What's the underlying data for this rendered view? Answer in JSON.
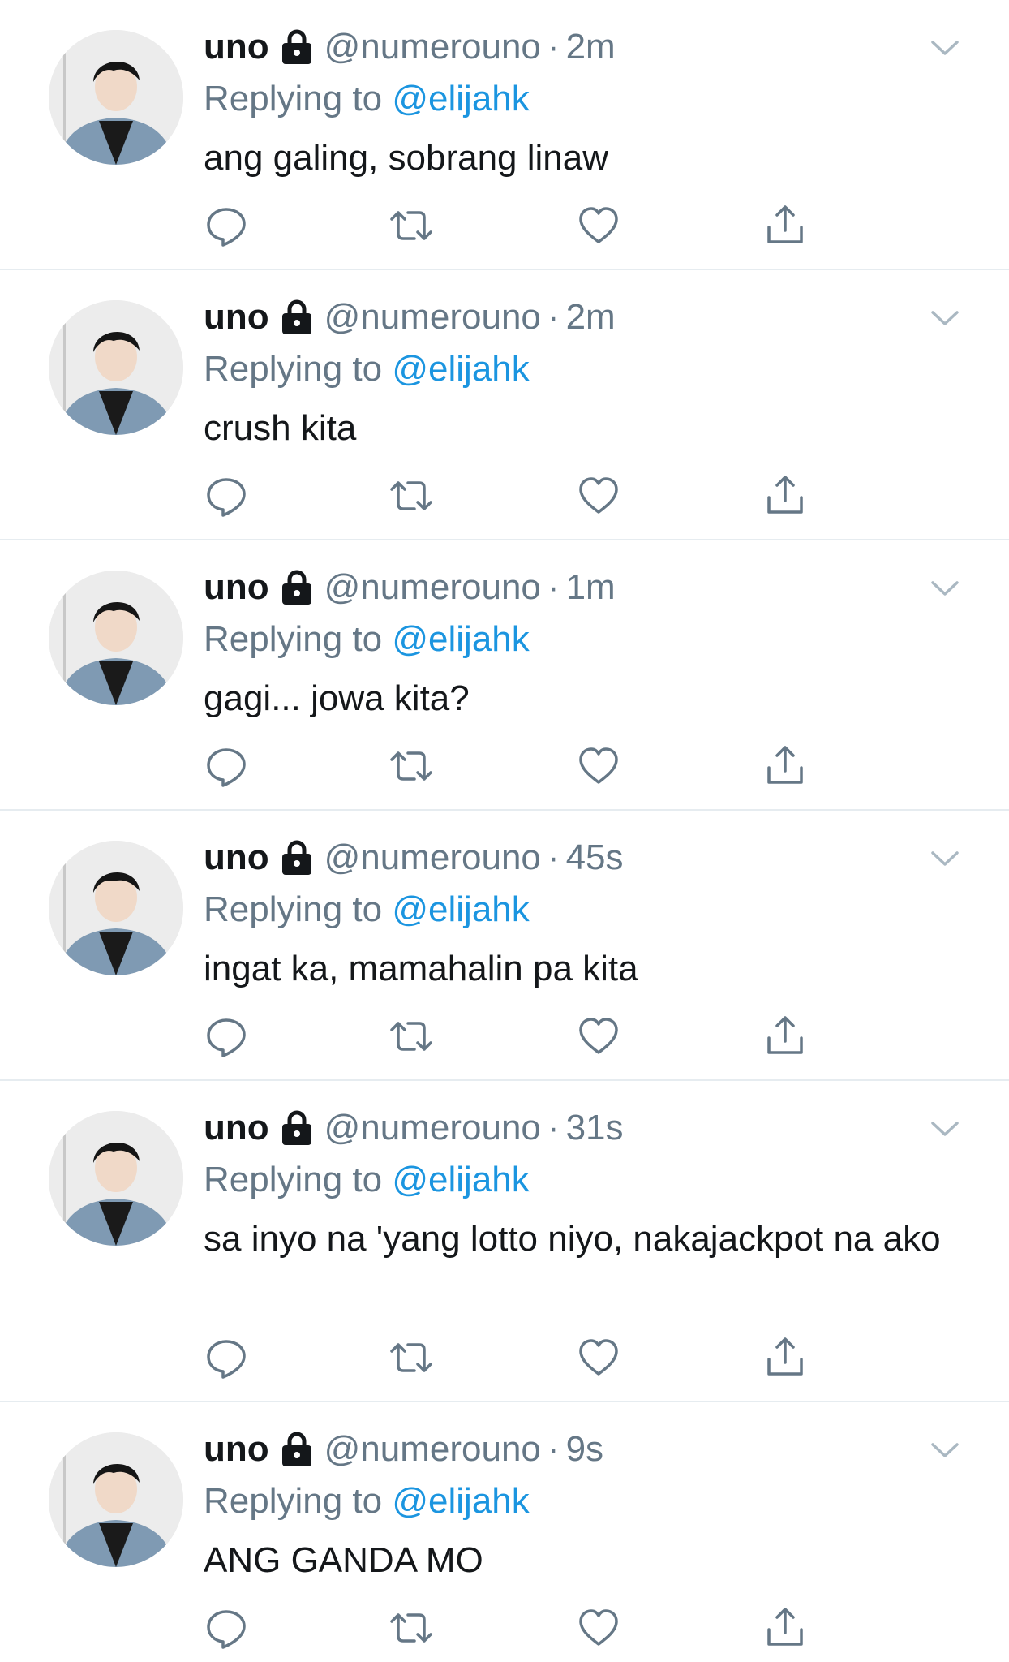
{
  "tweets": [
    {
      "name": "uno",
      "handle": "@numerouno",
      "dot": "·",
      "time": "2m",
      "replying_prefix": "Replying to ",
      "replying_to": "@elijahk",
      "text": "ang galing, sobrang linaw"
    },
    {
      "name": "uno",
      "handle": "@numerouno",
      "dot": "·",
      "time": "2m",
      "replying_prefix": "Replying to ",
      "replying_to": "@elijahk",
      "text": "crush kita"
    },
    {
      "name": "uno",
      "handle": "@numerouno",
      "dot": "·",
      "time": "1m",
      "replying_prefix": "Replying to ",
      "replying_to": "@elijahk",
      "text": "gagi... jowa kita?"
    },
    {
      "name": "uno",
      "handle": "@numerouno",
      "dot": "·",
      "time": "45s",
      "replying_prefix": "Replying to ",
      "replying_to": "@elijahk",
      "text": "ingat ka, mamahalin pa kita"
    },
    {
      "name": "uno",
      "handle": "@numerouno",
      "dot": "·",
      "time": "31s",
      "replying_prefix": "Replying to ",
      "replying_to": "@elijahk",
      "text": "sa inyo na 'yang lotto niyo, nakajackpot na ako"
    },
    {
      "name": "uno",
      "handle": "@numerouno",
      "dot": "·",
      "time": "9s",
      "replying_prefix": "Replying to ",
      "replying_to": "@elijahk",
      "text": "ANG GANDA MO"
    }
  ],
  "icons": {
    "lock": "lock-icon",
    "chevron": "chevron-down-icon",
    "reply": "reply-icon",
    "retweet": "retweet-icon",
    "like": "heart-icon",
    "share": "share-icon"
  },
  "colors": {
    "name": "#14171a",
    "secondary": "#657786",
    "mention": "#1b95e0",
    "divider": "#e6ecf0"
  }
}
